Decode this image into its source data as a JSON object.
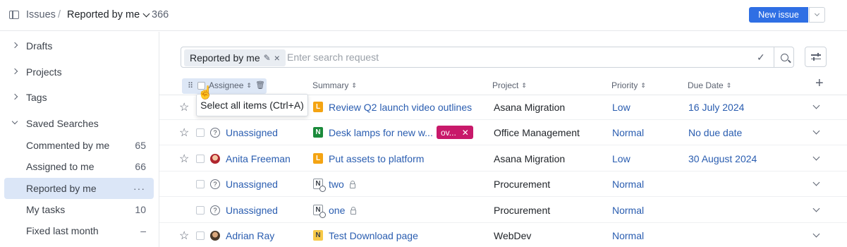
{
  "header": {
    "root": "Issues",
    "separator": "/",
    "current": "Reported by me",
    "count": "366",
    "new_issue_label": "New issue"
  },
  "sidebar": {
    "items": [
      {
        "label": "Drafts",
        "count": "",
        "type": "group",
        "expanded": false
      },
      {
        "label": "Projects",
        "count": "",
        "type": "group",
        "expanded": false
      },
      {
        "label": "Tags",
        "count": "",
        "type": "group",
        "expanded": false
      },
      {
        "label": "Saved Searches",
        "count": "",
        "type": "group",
        "expanded": true
      },
      {
        "label": "Commented by me",
        "count": "65",
        "type": "item"
      },
      {
        "label": "Assigned to me",
        "count": "66",
        "type": "item"
      },
      {
        "label": "Reported by me",
        "count": "···",
        "type": "item",
        "active": true
      },
      {
        "label": "My tasks",
        "count": "10",
        "type": "item"
      },
      {
        "label": "Fixed last month",
        "count": "–",
        "type": "item"
      }
    ]
  },
  "search": {
    "chip_label": "Reported by me",
    "chip_remove": "×",
    "placeholder": "Enter search request"
  },
  "table": {
    "columns": {
      "assignee": "Assignee",
      "summary": "Summary",
      "project": "Project",
      "priority": "Priority",
      "due": "Due Date"
    },
    "rows": [
      {
        "starred": true,
        "assignee": "",
        "avatar": "",
        "ptype": "L",
        "summary": "Review Q2 launch video outlines",
        "tag": "",
        "project": "Asana Migration",
        "priority": "Low",
        "due": "16 July 2024"
      },
      {
        "starred": true,
        "assignee": "Unassigned",
        "avatar": "?",
        "ptype": "N",
        "summary": "Desk lamps for new w...",
        "tag": "ov...",
        "project": "Office Management",
        "priority": "Normal",
        "due": "No due date"
      },
      {
        "starred": true,
        "assignee": "Anita Freeman",
        "avatar": "person-red",
        "ptype": "L",
        "summary": "Put assets to platform",
        "tag": "",
        "project": "Asana Migration",
        "priority": "Low",
        "due": "30 August 2024"
      },
      {
        "starred": false,
        "assignee": "Unassigned",
        "avatar": "?",
        "ptype": "N",
        "summary": "two",
        "tag": "",
        "project": "Procurement",
        "priority": "Normal",
        "due": ""
      },
      {
        "starred": false,
        "assignee": "Unassigned",
        "avatar": "?",
        "ptype": "N",
        "summary": "one",
        "tag": "",
        "project": "Procurement",
        "priority": "Normal",
        "due": ""
      },
      {
        "starred": true,
        "assignee": "Adrian Ray",
        "avatar": "person-brown",
        "ptype": "N",
        "summary": "Test Download page",
        "tag": "",
        "project": "WebDev",
        "priority": "Normal",
        "due": ""
      }
    ]
  },
  "tooltip": {
    "text": "Select all items (Ctrl+A)"
  },
  "colors": {
    "accent": "#2f6fe4",
    "link": "#2a5db0",
    "active_bg": "#dbe6f7",
    "tag_bg": "#c8196a",
    "ptype_L": "#f4a413",
    "ptype_N": "#1b8a3b"
  }
}
